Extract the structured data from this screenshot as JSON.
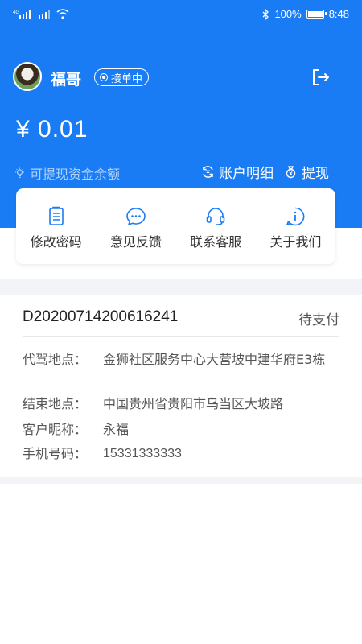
{
  "status_bar": {
    "signal_label": "4G",
    "battery_pct": "100%",
    "battery_level": 1.0,
    "time": "8:48"
  },
  "profile": {
    "name": "福哥",
    "status_badge": "接单中"
  },
  "balance": {
    "amount": "¥ 0.01",
    "caption": "可提现资金余额",
    "account_detail_label": "账户明细",
    "withdraw_label": "提现"
  },
  "menu": {
    "items": [
      {
        "label": "修改密码",
        "icon": "clipboard-icon"
      },
      {
        "label": "意见反馈",
        "icon": "chat-bubble-icon"
      },
      {
        "label": "联系客服",
        "icon": "headset-icon"
      },
      {
        "label": "关于我们",
        "icon": "info-icon"
      }
    ]
  },
  "order": {
    "number": "D20200714200616241",
    "status": "待支付",
    "rows": [
      {
        "key": "代驾地点：",
        "value": "金狮社区服务中心大营坡中建华府E3栋"
      },
      {
        "key": "结束地点：",
        "value": "中国贵州省贵阳市乌当区大坡路"
      },
      {
        "key": "客户昵称：",
        "value": "永福"
      },
      {
        "key": "手机号码：",
        "value": "15331333333"
      }
    ]
  },
  "colors": {
    "brand_blue": "#1a7cf5",
    "background_gray": "#f3f4f8"
  }
}
